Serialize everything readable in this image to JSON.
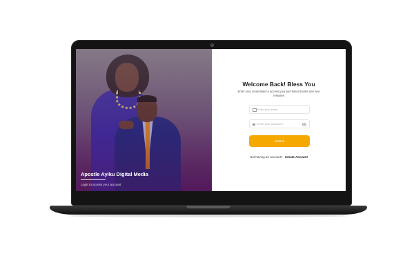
{
  "hero": {
    "title": "Apostle Ayiku Digital Media",
    "subtitle": "Login to access your account"
  },
  "login": {
    "title": "Welcome Back! Bless You",
    "description": "Enter your credentials to access your purchased books and new releases",
    "email": {
      "placeholder": "Enter your email",
      "value": "",
      "icon": "mail-icon"
    },
    "password": {
      "placeholder": "Enter your password",
      "value": "",
      "icon": "lock-icon",
      "toggle_icon": "eye-icon"
    },
    "submit_label": "Submit",
    "no_account_text": "Not having an account?",
    "create_account_label": "Create Account"
  },
  "colors": {
    "accent": "#f5a800",
    "hero_overlay": "#57205e",
    "laptop_frame": "#141414"
  }
}
